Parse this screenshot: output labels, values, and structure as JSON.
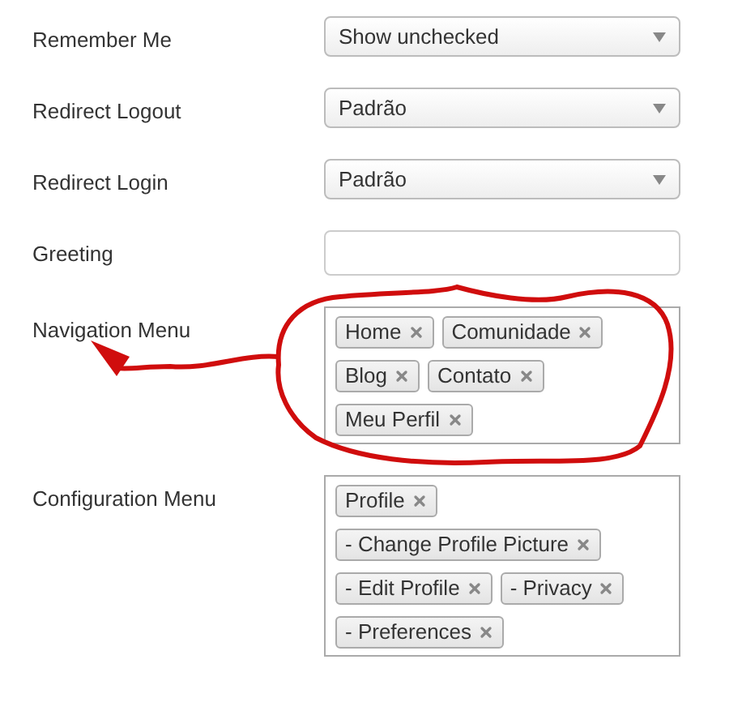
{
  "fields": [
    {
      "label": "Remember Me",
      "kind": "select",
      "value": "Show unchecked"
    },
    {
      "label": "Redirect Logout",
      "kind": "select",
      "value": "Padrão"
    },
    {
      "label": "Redirect Login",
      "kind": "select",
      "value": "Padrão"
    },
    {
      "label": "Greeting",
      "kind": "text"
    },
    {
      "label": "Navigation Menu",
      "kind": "tags",
      "tags": [
        "Home",
        "Comunidade",
        "Blog",
        "Contato",
        "Meu Perfil"
      ]
    },
    {
      "label": "Configuration Menu",
      "kind": "tags",
      "tags": [
        "Profile",
        "- Change Profile Picture",
        "- Edit Profile",
        "- Privacy",
        "- Preferences"
      ]
    }
  ]
}
